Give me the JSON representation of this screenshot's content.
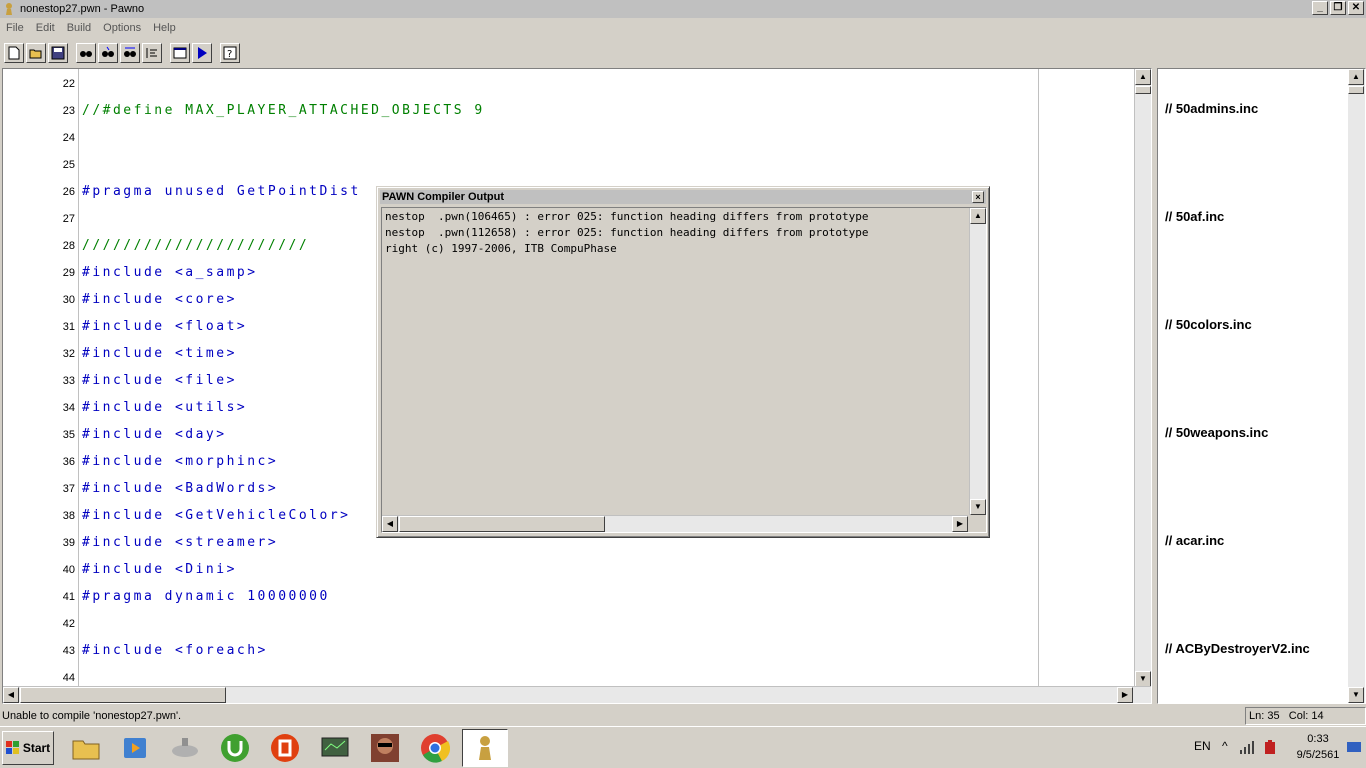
{
  "window": {
    "title": "nonestop27.pwn - Pawno"
  },
  "menu": [
    "File",
    "Edit",
    "Build",
    "Options",
    "Help"
  ],
  "toolbar": {
    "icons": [
      "new-file-icon",
      "open-file-icon",
      "save-icon",
      "find-icon",
      "find-next-icon",
      "replace-icon",
      "goto-icon",
      "compile-icon",
      "run-icon",
      "help-icon"
    ]
  },
  "editor": {
    "lines": [
      {
        "num": "22",
        "text": "",
        "color": "green"
      },
      {
        "num": "23",
        "text": "//#define MAX_PLAYER_ATTACHED_OBJECTS 9",
        "color": "green"
      },
      {
        "num": "24",
        "text": "",
        "color": "green"
      },
      {
        "num": "25",
        "text": "",
        "color": "green"
      },
      {
        "num": "26",
        "text": "#pragma unused GetPointDist",
        "color": "blue"
      },
      {
        "num": "27",
        "text": "",
        "color": "green"
      },
      {
        "num": "28",
        "text": "//////////////////////",
        "color": "green"
      },
      {
        "num": "29",
        "text": "#include <a_samp>",
        "color": "blue"
      },
      {
        "num": "30",
        "text": "#include <core>",
        "color": "blue"
      },
      {
        "num": "31",
        "text": "#include <float>",
        "color": "blue"
      },
      {
        "num": "32",
        "text": "#include <time>",
        "color": "blue"
      },
      {
        "num": "33",
        "text": "#include <file>",
        "color": "blue"
      },
      {
        "num": "34",
        "text": "#include <utils>",
        "color": "blue"
      },
      {
        "num": "35",
        "text": "#include <day>",
        "color": "blue"
      },
      {
        "num": "36",
        "text": "#include <morphinc>",
        "color": "blue"
      },
      {
        "num": "37",
        "text": "#include <BadWords>",
        "color": "blue"
      },
      {
        "num": "38",
        "text": "#include <GetVehicleColor>",
        "color": "blue"
      },
      {
        "num": "39",
        "text": "#include <streamer>",
        "color": "blue"
      },
      {
        "num": "40",
        "text": "#include <Dini>",
        "color": "blue"
      },
      {
        "num": "41",
        "text": "#pragma dynamic 10000000",
        "color": "blue"
      },
      {
        "num": "42",
        "text": "",
        "color": "blue"
      },
      {
        "num": "43",
        "text": "#include <foreach>",
        "color": "blue"
      },
      {
        "num": "44",
        "text": "",
        "color": "blue"
      }
    ]
  },
  "side_panel": {
    "items": [
      "// 50admins.inc",
      "// 50af.inc",
      "// 50colors.inc",
      "// 50weapons.inc",
      "// acar.inc",
      "// ACByDestroyerV2.inc"
    ]
  },
  "dialog": {
    "title": "PAWN Compiler Output",
    "close": "×",
    "lines": [
      "nestop  .pwn(106465) : error 025: function heading differs from prototype",
      "nestop  .pwn(112658) : error 025: function heading differs from prototype",
      "right (c) 1997-2006, ITB CompuPhase"
    ]
  },
  "status": {
    "message": "Unable to compile 'nonestop27.pwn'.",
    "ln_label": "Ln: 35",
    "col_label": "Col: 14"
  },
  "taskbar": {
    "start": "Start",
    "lang": "EN",
    "time": "0:33",
    "date": "9/5/2561"
  },
  "colors": {
    "green": "#008000",
    "blue": "#0000c0"
  }
}
